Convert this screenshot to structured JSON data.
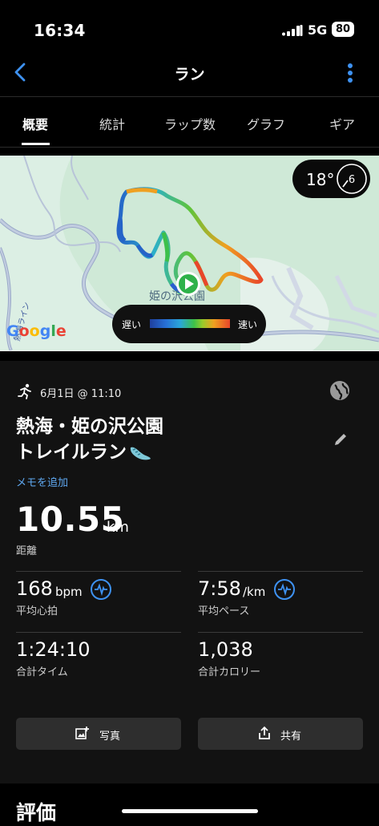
{
  "status_bar": {
    "time": "16:34",
    "network": "5G",
    "battery": "80"
  },
  "header": {
    "title": "ラン",
    "back_icon": "chevron-left-icon",
    "more_icon": "vertical-ellipsis-icon"
  },
  "tabs": [
    {
      "label": "概要",
      "active": true
    },
    {
      "label": "統計",
      "active": false
    },
    {
      "label": "ラップ数",
      "active": false
    },
    {
      "label": "グラフ",
      "active": false
    },
    {
      "label": "ギア",
      "active": false
    }
  ],
  "map": {
    "temperature": "18°",
    "wind": "6",
    "place_label": "姫の沢公園",
    "road_label": "熱海ライン",
    "speed_legend": {
      "slow": "遅い",
      "fast": "速い"
    },
    "attribution": "Google"
  },
  "activity": {
    "date": "6月1日 @ 11:10",
    "title_line1": "熱海・姫の沢公園",
    "title_line2": "トレイルラン",
    "add_memo": "メモを追加",
    "distance": {
      "value": "10.55",
      "unit": "km",
      "label": "距離"
    },
    "stats": {
      "heart_rate": {
        "value": "168",
        "unit": "bpm",
        "label": "平均心拍"
      },
      "pace": {
        "value": "7:58",
        "unit": "/km",
        "label": "平均ペース"
      },
      "total_time": {
        "value": "1:24:10",
        "label": "合計タイム"
      },
      "calories": {
        "value": "1,038",
        "label": "合計カロリー"
      }
    },
    "buttons": {
      "photo": "写真",
      "share": "共有"
    }
  },
  "evaluation": {
    "title": "評価"
  },
  "colors": {
    "accent_blue": "#3e92f2",
    "link_blue": "#5fa8f0",
    "start_marker": "#2eb24a"
  }
}
